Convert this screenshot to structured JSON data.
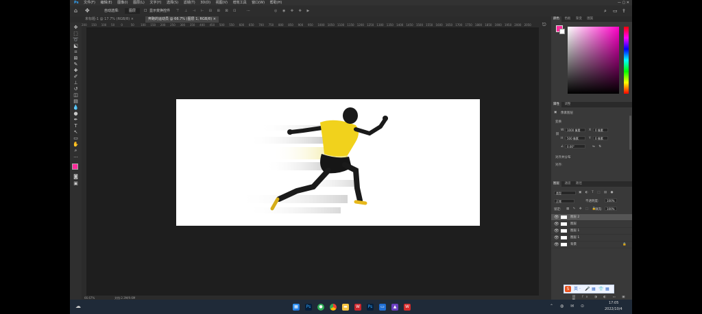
{
  "app": {
    "name": "Ps"
  },
  "menu": {
    "items": [
      "文件(F)",
      "编辑(E)",
      "图像(I)",
      "图层(L)",
      "文字(Y)",
      "选择(S)",
      "滤镜(T)",
      "3D(D)",
      "视图(V)",
      "增效工具",
      "窗口(W)",
      "帮助(H)"
    ]
  },
  "options": {
    "auto_select_label": "自动选择:",
    "auto_select_value": "图层",
    "show_transform_label": "显示变换控件",
    "more": "···"
  },
  "tabs": [
    {
      "label": "未标题-1 @ 17.7% (RGB/8) ×",
      "active": false
    },
    {
      "label": "奔跑的运动员 @ 66.7% (图层 1, RGB/8) ×",
      "active": true
    }
  ],
  "ruler": {
    "ticks": [
      "200",
      "150",
      "100",
      "50",
      "0",
      "50",
      "100",
      "150",
      "200",
      "250",
      "300",
      "350",
      "400",
      "450",
      "500",
      "550",
      "600",
      "650",
      "700",
      "750",
      "800",
      "850",
      "900",
      "950",
      "1000",
      "1050",
      "1100",
      "1150",
      "1200",
      "1250",
      "1300",
      "1350",
      "1400",
      "1450",
      "1500",
      "1550",
      "1600",
      "1650",
      "1700",
      "1750",
      "1800",
      "1850",
      "1900",
      "1950",
      "2000",
      "2050"
    ]
  },
  "status": {
    "zoom": "66.67%",
    "doc": "文档:2.3M/9.6M"
  },
  "panels": {
    "color_tabs": [
      "颜色",
      "色板",
      "渐变",
      "图案"
    ],
    "properties_tabs": [
      "属性",
      "调整"
    ],
    "properties_title": "像素图层",
    "transform_label": "变换",
    "w_label": "W",
    "w_value": "1000 像素",
    "h_label": "H",
    "h_value": "500 像素",
    "x_label": "X",
    "x_value": "0 像素",
    "y_label": "Y",
    "y_value": "0 像素",
    "angle_value": "0.00°",
    "align_label": "对齐并分布",
    "align_sub": "对齐:",
    "layers_tabs": [
      "图层",
      "通道",
      "路径"
    ],
    "kind_label": "类型",
    "blend_mode": "正常",
    "opacity_label": "不透明度:",
    "opacity_value": "100%",
    "lock_label": "锁定:",
    "fill_label": "填充:",
    "fill_value": "100%",
    "layers": [
      {
        "name": "图层 2",
        "selected": true
      },
      {
        "name": "图层",
        "selected": false
      },
      {
        "name": "图层 1",
        "selected": false
      },
      {
        "name": "图层 1",
        "selected": false
      },
      {
        "name": "背景",
        "selected": false
      }
    ]
  },
  "ime_bar": {
    "items": [
      "S",
      "英",
      "·",
      "🎤",
      "▦",
      "👕",
      "▦"
    ]
  },
  "taskbar": {
    "time": "17:05",
    "date": "2022/10/4",
    "icons": [
      "windows-icon",
      "search-icon",
      "ps-icon",
      "chrome-icon",
      "folder-icon",
      "w-icon",
      "ps2-icon",
      "app-icon",
      "app2-icon",
      "wps-icon"
    ]
  },
  "colors": {
    "ps_bg": "#535353",
    "canvas_dark": "#1e1e1e",
    "fg_color": "#ff2a9b",
    "jersey": "#f1d21c",
    "taskbar": "#1f2a38"
  }
}
